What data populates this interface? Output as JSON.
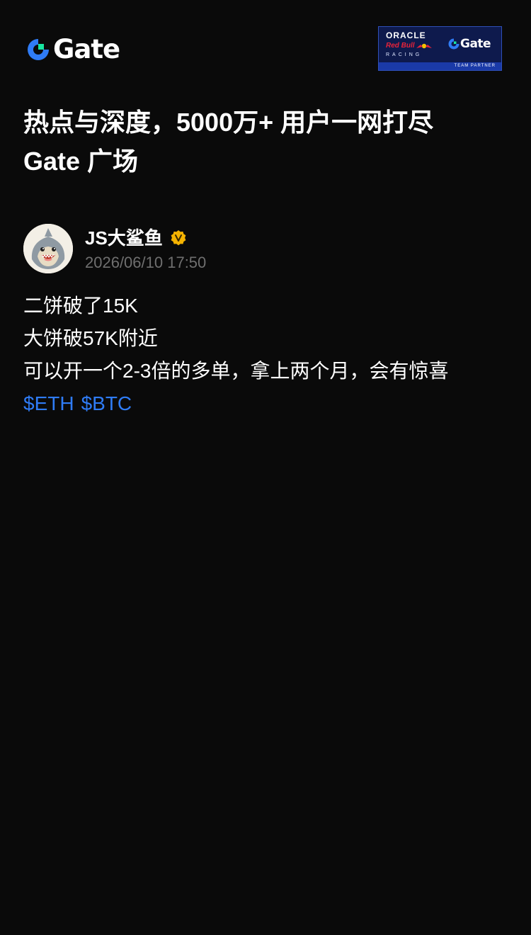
{
  "header": {
    "logo_text": "Gate",
    "partner_badge": {
      "oracle": "ORACLE",
      "redbull": "Red Bull",
      "racing": "RACING",
      "gate": "Gate",
      "team_partner": "TEAM PARTNER"
    }
  },
  "title": {
    "line1": "热点与深度，5000万+ 用户一网打尽",
    "line2": "Gate 广场"
  },
  "post": {
    "author": "JS大鲨鱼",
    "verified": true,
    "date": "2026/06/10 17:50",
    "lines": [
      "二饼破了15K",
      "大饼破57K附近",
      "可以开一个2-3倍的多单，拿上两个月，会有惊喜"
    ],
    "tags": [
      "$ETH",
      "$BTC"
    ]
  },
  "colors": {
    "background": "#0a0a0a",
    "text": "#ffffff",
    "muted": "#6f6f6f",
    "link": "#2f7cf6",
    "brand_blue": "#2f7cf6",
    "brand_green": "#17e6a1",
    "verified_badge": "#f5b301"
  },
  "icons": {
    "logo": "gate-logo-icon",
    "verified": "verified-badge-icon",
    "avatar": "shark-avatar"
  }
}
